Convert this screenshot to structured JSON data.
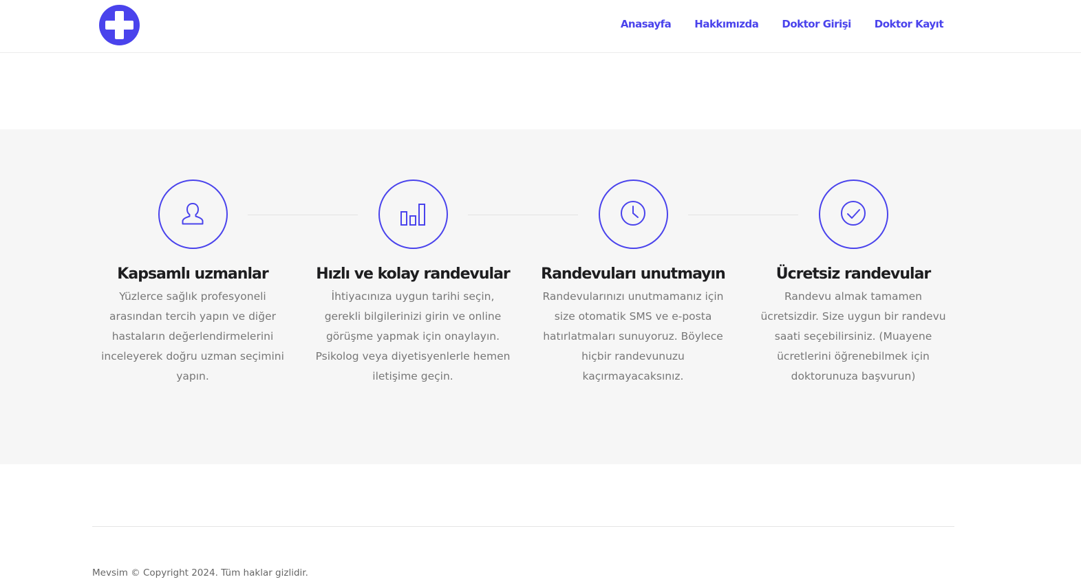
{
  "brand": {
    "logo_icon": "medical-cross-icon",
    "accent_color": "#4a43ec"
  },
  "nav": {
    "items": [
      {
        "label": "Anasayfa"
      },
      {
        "label": "Hakkımızda"
      },
      {
        "label": "Doktor Girişi"
      },
      {
        "label": "Doktor Kayıt"
      }
    ]
  },
  "features": [
    {
      "icon": "user-icon",
      "title": "Kapsamlı uzmanlar",
      "text": "Yüzlerce sağlık profesyoneli arasından tercih yapın ve diğer hastaların değerlendirmelerini inceleyerek doğru uzman seçimini yapın."
    },
    {
      "icon": "bar-chart-icon",
      "title": "Hızlı ve kolay randevular",
      "text": "İhtiyacınıza uygun tarihi seçin, gerekli bilgilerinizi girin ve online görüşme yapmak için onaylayın. Psikolog veya diyetisyenlerle hemen iletişime geçin."
    },
    {
      "icon": "clock-icon",
      "title": "Randevuları unutmayın",
      "text": "Randevularınızı unutmamanız için size otomatik SMS ve e-posta hatırlatmaları sunuyoruz. Böylece hiçbir randevunuzu kaçırmayacaksınız."
    },
    {
      "icon": "check-circle-icon",
      "title": "Ücretsiz randevular",
      "text": "Randevu almak tamamen ücretsizdir. Size uygun bir randevu saati seçebilirsiniz. (Muayene ücretlerini öğrenebilmek için doktorunuza başvurun)"
    }
  ],
  "footer": {
    "copyright": "Mevsim © Copyright 2024. Tüm haklar gizlidir."
  }
}
